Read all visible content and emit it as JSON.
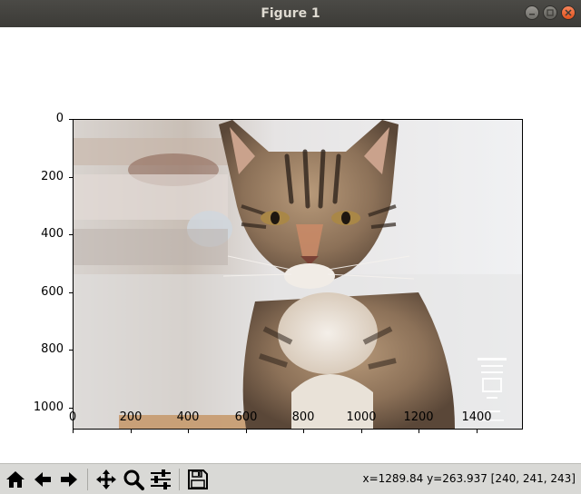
{
  "window": {
    "title": "Figure 1"
  },
  "figure": {
    "image_description_icon": "cat-photo",
    "y_ticks": [
      "0",
      "200",
      "400",
      "600",
      "800",
      "1000"
    ],
    "x_ticks": [
      "0",
      "200",
      "400",
      "600",
      "800",
      "1000",
      "1200",
      "1400"
    ],
    "xlim": [
      0,
      1560
    ],
    "ylim": [
      1080,
      0
    ]
  },
  "toolbar": {
    "buttons": [
      {
        "name": "home-button",
        "icon": "home-icon"
      },
      {
        "name": "back-button",
        "icon": "arrow-left-icon"
      },
      {
        "name": "forward-button",
        "icon": "arrow-right-icon"
      },
      {
        "name": "pan-button",
        "icon": "move-icon"
      },
      {
        "name": "zoom-button",
        "icon": "magnifier-icon"
      },
      {
        "name": "configure-subplots-button",
        "icon": "sliders-icon"
      },
      {
        "name": "save-button",
        "icon": "floppy-disk-icon"
      }
    ],
    "status": "x=1289.84  y=263.937  [240, 241, 243]"
  }
}
